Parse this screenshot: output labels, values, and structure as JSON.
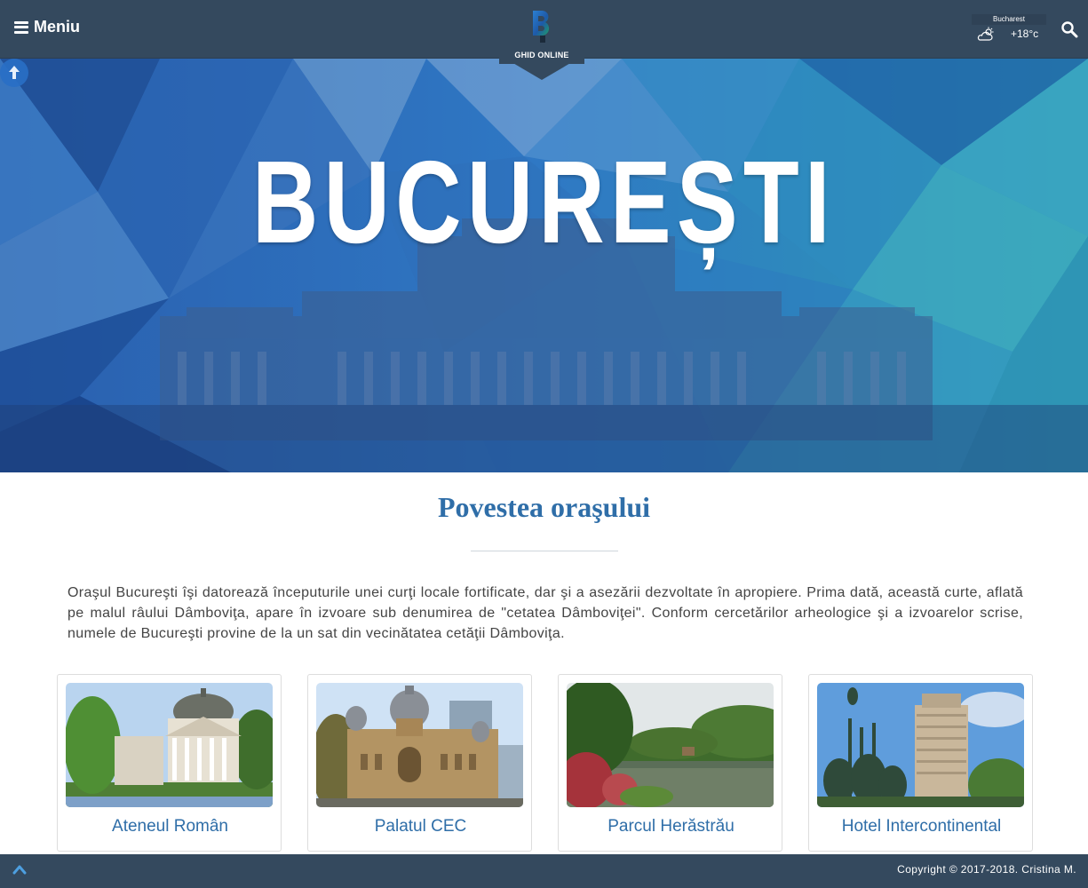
{
  "header": {
    "menu_label": "Meniu",
    "logo_caption": "GHID ONLINE",
    "weather": {
      "city": "Bucharest",
      "temperature": "+18°c",
      "icon": "partly-cloudy-icon"
    }
  },
  "hero": {
    "title": "BUCUREȘTI",
    "scroll_icon": "arrow-up-icon"
  },
  "main": {
    "section_title": "Povestea oraşului",
    "intro": "Oraşul Bucureşti îşi datorează începuturile unei curţi locale fortificate, dar şi a asezării dezvoltate în apropiere. Prima dată, această curte, aflată pe malul râului Dâmboviţa, apare în izvoare sub denumirea de \"cetatea Dâmboviţei\". Conform cercetărilor arheologice şi a izvoarelor scrise, numele de Bucureşti provine de la un sat din vecinătatea cetăţii Dâmboviţa.",
    "cards": [
      {
        "label": "Ateneul Român"
      },
      {
        "label": "Palatul CEC"
      },
      {
        "label": "Parcul Herăstrău"
      },
      {
        "label": "Hotel Intercontinental"
      }
    ]
  },
  "footer": {
    "copyright": "Copyright © 2017-2018. Cristina M."
  },
  "colors": {
    "header_bg": "#34495e",
    "accent_blue": "#2f6ea8",
    "hero_blue": "#2e6fb3"
  }
}
